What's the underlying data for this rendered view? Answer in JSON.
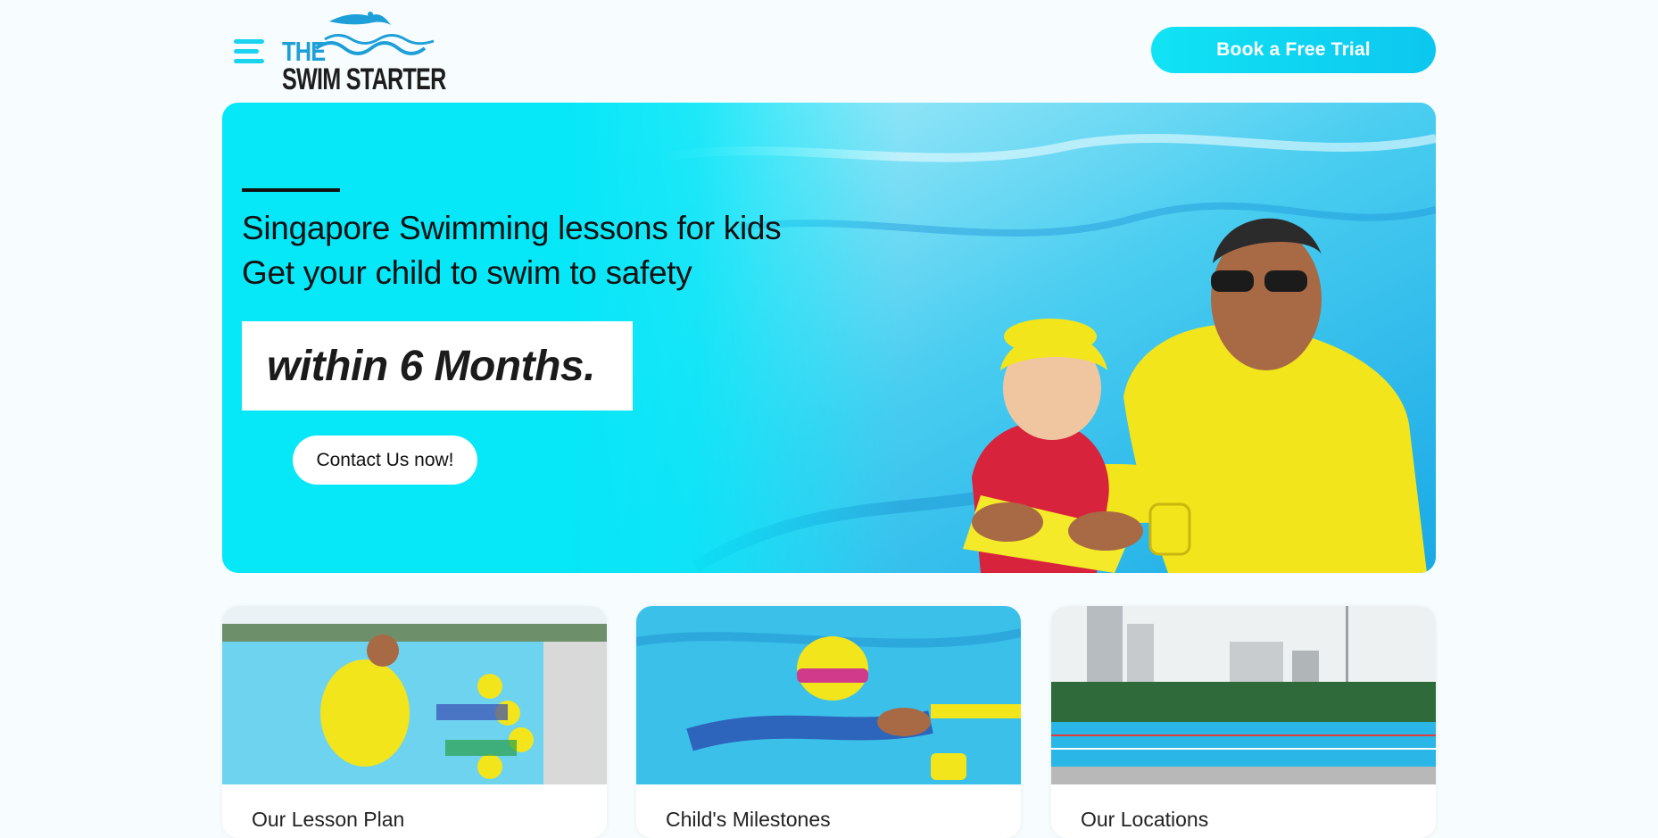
{
  "header": {
    "menu_icon": "hamburger-menu-icon",
    "logo": {
      "line1": "THE",
      "line2": "SWIM STARTER"
    },
    "cta_label": "Book a Free Trial"
  },
  "hero": {
    "line1": "Singapore Swimming lessons for kids",
    "line2": "Get your child to swim to safety",
    "highlight": "within 6 Months.",
    "contact_label": "Contact Us now!"
  },
  "cards": [
    {
      "title": "Our Lesson Plan"
    },
    {
      "title": "Child's Milestones"
    },
    {
      "title": "Our Locations"
    }
  ],
  "colors": {
    "accent": "#06e7f8",
    "cta": "#11e3f4",
    "logo_blue": "#1e9fd8",
    "coach_yellow": "#f2e51b"
  }
}
